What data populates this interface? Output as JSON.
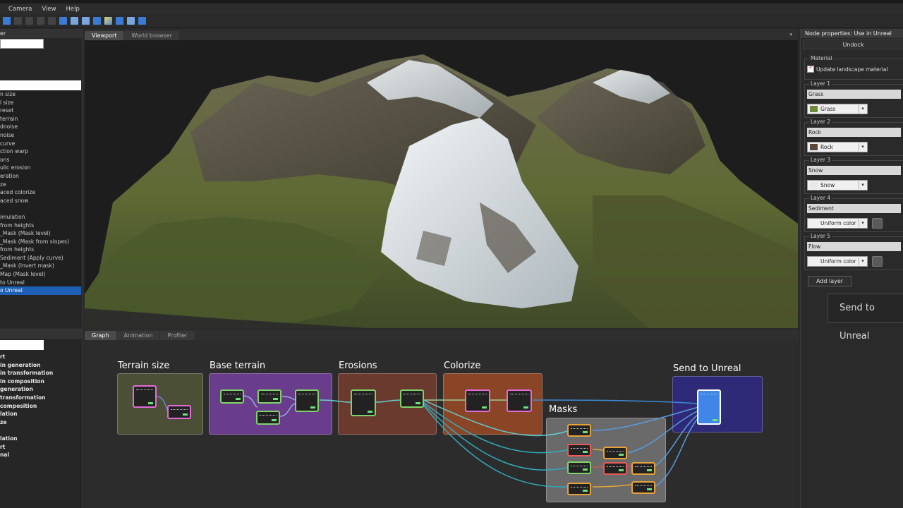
{
  "menu": [
    "Camera",
    "View",
    "Help"
  ],
  "left_panel": {
    "header": "er",
    "items": [
      "n size",
      "l size",
      "reset",
      "terrain",
      "dnoise",
      "noise",
      "curve",
      "ction warp",
      "ons",
      "ulic erosion",
      "eration",
      "ze",
      "aced colorize",
      "aced snow",
      "",
      "imulation",
      "from heights",
      "_Mask (Mask level)",
      "_Mask (Mask from slopes)",
      "from heights",
      "Sediment (Apply curve)",
      "_Mask (Invert mask)",
      "Map (Mask level)",
      "to Unreal",
      "o Unreal"
    ],
    "selected_index": 24,
    "categories": [
      "rt",
      "in generation",
      "in transformation",
      "in composition",
      "generation",
      "transformation",
      "composition",
      "lation",
      "ze",
      "",
      "lation",
      "rt",
      "nal"
    ]
  },
  "viewport": {
    "tabs": [
      "Viewport",
      "World browser"
    ],
    "close": "▾"
  },
  "graph": {
    "tabs": [
      "Graph",
      "Animation",
      "Profiler"
    ],
    "groups": {
      "terrain_size": "Terrain size",
      "base_terrain": "Base terrain",
      "erosions": "Erosions",
      "colorize": "Colorize",
      "masks": "Masks",
      "send_to_unreal": "Send to Unreal"
    }
  },
  "right_panel": {
    "title": "Node properties: Use in Unreal",
    "undock": "Undock",
    "material_label": "Material",
    "update_landscape": "Update landscape material",
    "layers": [
      {
        "label": "Layer 1",
        "name": "Grass",
        "combo": "Grass",
        "swatch": "#6f8a3a"
      },
      {
        "label": "Layer 2",
        "name": "Rock",
        "combo": "Rock",
        "swatch": "#5a4a3e"
      },
      {
        "label": "Layer 3",
        "name": "Snow",
        "combo": "Snow",
        "swatch": "#e8e8e8"
      },
      {
        "label": "Layer 4",
        "name": "Sediment",
        "combo": "Uniform color",
        "swatch": ""
      },
      {
        "label": "Layer 5",
        "name": "Flow",
        "combo": "Uniform color",
        "swatch": ""
      }
    ],
    "add_layer": "Add layer",
    "send_button": "Send to Unreal"
  },
  "colors": {
    "selection": "#1e5fb8",
    "accent_blue": "#3a7bd5"
  }
}
